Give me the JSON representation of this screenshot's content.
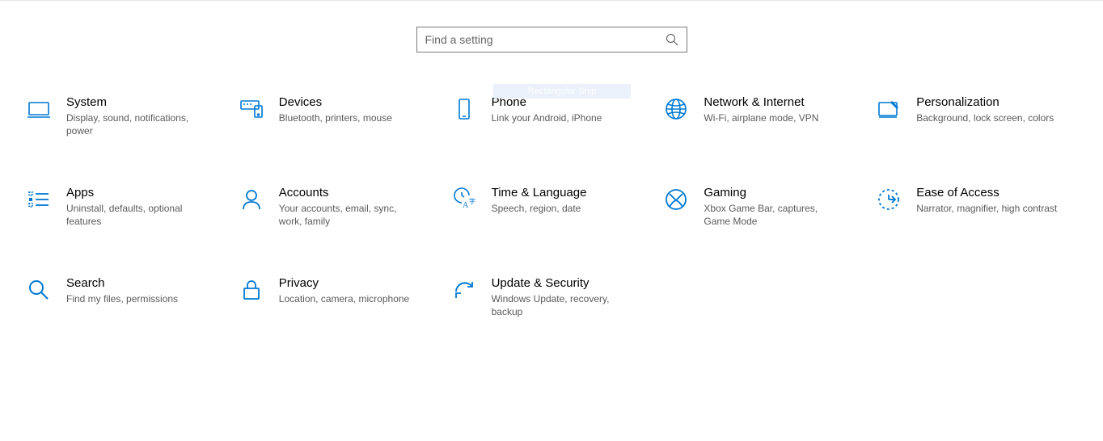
{
  "search": {
    "placeholder": "Find a setting"
  },
  "snip_overlay": "Rectangular Snip",
  "tiles": {
    "system": {
      "title": "System",
      "desc": "Display, sound, notifications, power"
    },
    "devices": {
      "title": "Devices",
      "desc": "Bluetooth, printers, mouse"
    },
    "phone": {
      "title": "Phone",
      "desc": "Link your Android, iPhone"
    },
    "network": {
      "title": "Network & Internet",
      "desc": "Wi-Fi, airplane mode, VPN"
    },
    "personalization": {
      "title": "Personalization",
      "desc": "Background, lock screen, colors"
    },
    "apps": {
      "title": "Apps",
      "desc": "Uninstall, defaults, optional features"
    },
    "accounts": {
      "title": "Accounts",
      "desc": "Your accounts, email, sync, work, family"
    },
    "time": {
      "title": "Time & Language",
      "desc": "Speech, region, date"
    },
    "gaming": {
      "title": "Gaming",
      "desc": "Xbox Game Bar, captures, Game Mode"
    },
    "ease": {
      "title": "Ease of Access",
      "desc": "Narrator, magnifier, high contrast"
    },
    "searchTile": {
      "title": "Search",
      "desc": "Find my files, permissions"
    },
    "privacy": {
      "title": "Privacy",
      "desc": "Location, camera, microphone"
    },
    "update": {
      "title": "Update & Security",
      "desc": "Windows Update, recovery, backup"
    }
  }
}
